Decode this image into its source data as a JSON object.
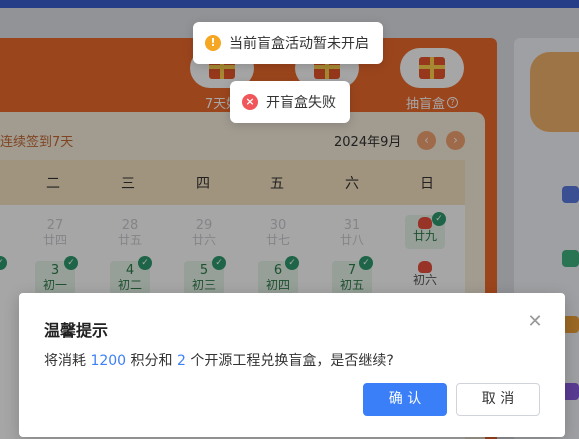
{
  "toasts": {
    "warning_text": "当前盲盒活动暂未开启",
    "error_text": "开盲盒失败"
  },
  "rewards": {
    "seven_day_label": "7天好",
    "draw_label": "抽盲盒"
  },
  "calendar": {
    "streak_text": "连续签到7天",
    "month_label": "2024年9月",
    "weekdays": [
      "二",
      "三",
      "四",
      "五",
      "六",
      "日"
    ],
    "week1": [
      {
        "num": "27",
        "lunar": "廿四"
      },
      {
        "num": "28",
        "lunar": "廿五"
      },
      {
        "num": "29",
        "lunar": "廿六"
      },
      {
        "num": "30",
        "lunar": "廿七"
      },
      {
        "num": "31",
        "lunar": "廿八"
      },
      {
        "num": "",
        "lunar": "廿九"
      }
    ],
    "week2": [
      {
        "num": "3",
        "lunar": "初一"
      },
      {
        "num": "4",
        "lunar": "初二"
      },
      {
        "num": "5",
        "lunar": "初三"
      },
      {
        "num": "6",
        "lunar": "初四"
      },
      {
        "num": "7",
        "lunar": "初五"
      },
      {
        "num": "",
        "lunar": "初六"
      }
    ]
  },
  "dialog": {
    "title": "温馨提示",
    "msg_prefix": "将消耗 ",
    "points": "1200",
    "msg_mid": " 积分和 ",
    "count": "2",
    "msg_suffix": " 个开源工程兑换盲盒，是否继续?",
    "confirm_label": "确 认",
    "cancel_label": "取 消"
  },
  "colors": {
    "accent_orange": "#ef6a2c",
    "primary_blue": "#3a7ff7",
    "signed_green": "#2e9a6f"
  }
}
